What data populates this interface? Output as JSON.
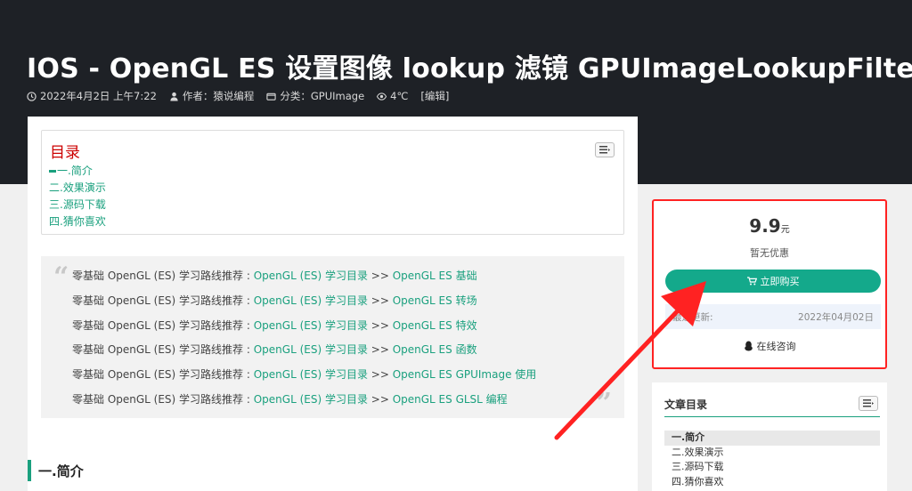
{
  "header": {
    "title": "IOS - OpenGL ES 设置图像 lookup 滤镜 GPUImageLookupFilter",
    "date": "2022年4月2日 上午7:22",
    "author": "作者：猿说编程",
    "category": "分类：GPUImage",
    "views": "4℃",
    "edit": "[编辑]"
  },
  "toc": {
    "title": "目录",
    "items": [
      "一.简介",
      "二.效果演示",
      "三.源码下载",
      "四.猜你喜欢"
    ]
  },
  "quote": {
    "lines": [
      {
        "prefix": "零基础 OpenGL (ES) 学习路线推荐 : ",
        "link1": "OpenGL (ES) 学习目录",
        "sep": " >> ",
        "link2": "OpenGL ES 基础"
      },
      {
        "prefix": "零基础 OpenGL (ES) 学习路线推荐 : ",
        "link1": "OpenGL (ES) 学习目录",
        "sep": " >> ",
        "link2": "OpenGL ES 转场"
      },
      {
        "prefix": "零基础 OpenGL (ES) 学习路线推荐 : ",
        "link1": "OpenGL (ES) 学习目录",
        "sep": " >> ",
        "link2": "OpenGL ES 特效"
      },
      {
        "prefix": "零基础 OpenGL (ES) 学习路线推荐 : ",
        "link1": "OpenGL (ES) 学习目录",
        "sep": " >> ",
        "link2": "OpenGL ES 函数"
      },
      {
        "prefix": "零基础 OpenGL (ES) 学习路线推荐 : ",
        "link1": "OpenGL (ES) 学习目录",
        "sep": " >> ",
        "link2": "OpenGL ES GPUImage 使用"
      },
      {
        "prefix": "零基础 OpenGL (ES) 学习路线推荐 : ",
        "link1": "OpenGL (ES) 学习目录",
        "sep": " >> ",
        "link2": "OpenGL ES GLSL 编程"
      }
    ]
  },
  "section": {
    "heading": "一.简介"
  },
  "buy": {
    "price": "9.9",
    "currency": "元",
    "discount": "暂无优惠",
    "button": "立即购买",
    "update_label": "最近更新:",
    "update_date": "2022年04月02日",
    "consult": "在线咨询"
  },
  "side_toc": {
    "title": "文章目录",
    "items": [
      "一.简介",
      "二.效果演示",
      "三.源码下载",
      "四.猜你喜欢"
    ]
  },
  "colors": {
    "accent": "#1aa07e",
    "button": "#14a98b",
    "highlight_border": "#ff2222",
    "header_bg": "#1e2126"
  }
}
